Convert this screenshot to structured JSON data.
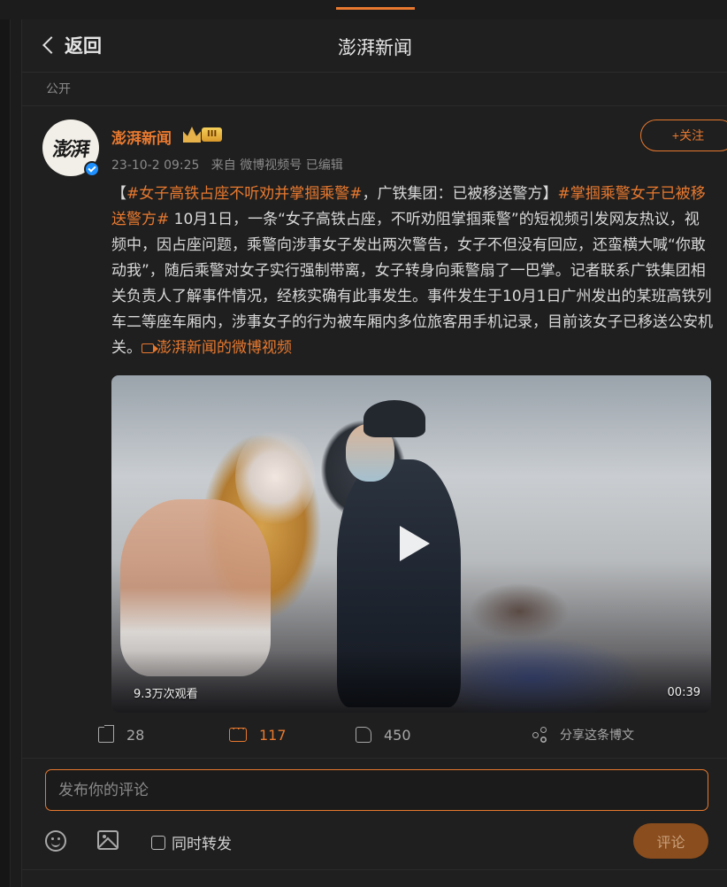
{
  "nav": {
    "back_label": "返回",
    "title": "澎湃新闻"
  },
  "visibility": "公开",
  "post": {
    "author": "澎湃新闻",
    "level_badge": "III",
    "timestamp": "23-10-2 09:25",
    "source": "来自 微博视频号",
    "edited": "已编辑",
    "follow_label": "+关注",
    "avatar_text": "澎湃",
    "content": {
      "bracket_open": "【",
      "tag1": "#女子高铁占座不听劝并掌掴乘警#",
      "after_tag1": "，广铁集团：已被移送警方】",
      "tag2": "#掌掴乘警女子已被移送警方#",
      "body": " 10月1日，一条“女子高铁占座，不听劝阻掌掴乘警”的短视频引发网友热议，视频中，因占座问题，乘警向涉事女子发出两次警告，女子不但没有回应，还蛮横大喊“你敢动我”，随后乘警对女子实行强制带离，女子转身向乘警扇了一巴掌。记者联系广铁集团相关负责人了解事件情况，经核实确有此事发生。事件发生于10月1日广州发出的某班高铁列车二等座车厢内，涉事女子的行为被车厢内多位旅客用手机记录，目前该女子已移送公安机关。",
      "video_link": "澎湃新闻的微博视频"
    },
    "video": {
      "views": "9.3万次观看",
      "duration": "00:39"
    },
    "actions": {
      "reposts": "28",
      "comments": "117",
      "likes": "450",
      "share_label": "分享这条博文"
    }
  },
  "comment_form": {
    "placeholder": "发布你的评论",
    "repost_label": "同时转发",
    "submit_label": "评论"
  },
  "colors": {
    "accent": "#e8792f",
    "background": "#1f1f1f",
    "verified": "#1e90ff"
  }
}
